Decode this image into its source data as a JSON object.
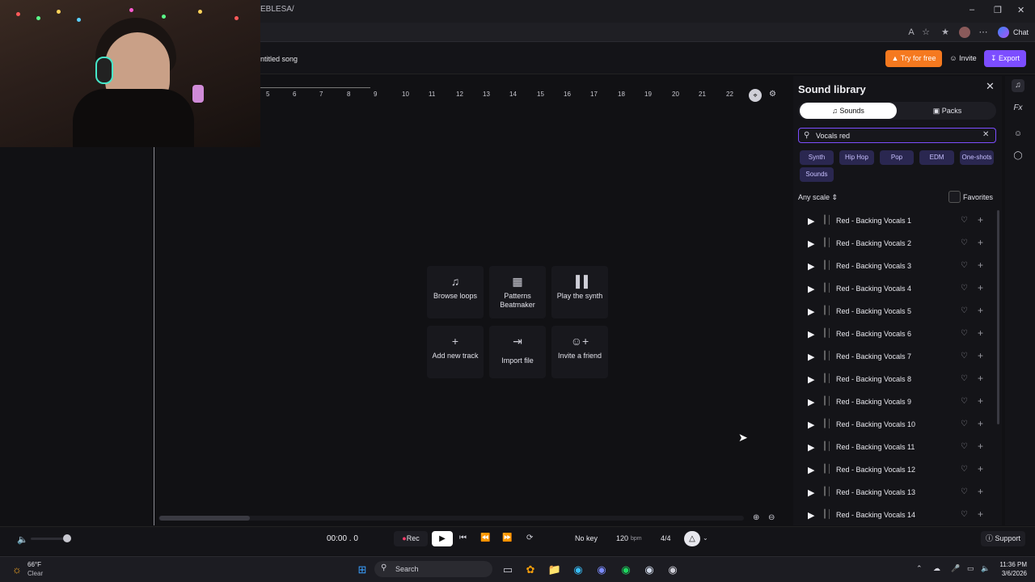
{
  "browser": {
    "url_fragment": "EBLESA/",
    "window_controls": [
      "minimize-icon",
      "restore-icon",
      "close-icon"
    ],
    "chat_label": "Chat"
  },
  "header": {
    "song_title": "ntitled song",
    "try_label": "Try for free",
    "invite_label": "Invite",
    "export_label": "Export"
  },
  "ruler": [
    "5",
    "6",
    "7",
    "8",
    "9",
    "10",
    "11",
    "12",
    "13",
    "14",
    "15",
    "16",
    "17",
    "18",
    "19",
    "20",
    "21",
    "22"
  ],
  "start_tiles": [
    {
      "label": "Browse loops",
      "icon": "music-note-icon"
    },
    {
      "label": "Patterns Beatmaker",
      "icon": "grid-icon"
    },
    {
      "label": "Play the synth",
      "icon": "piano-icon"
    },
    {
      "label": "Add new track",
      "icon": "plus-icon"
    },
    {
      "label": "Import file",
      "icon": "import-icon"
    },
    {
      "label": "Invite a friend",
      "icon": "add-user-icon"
    }
  ],
  "library": {
    "title": "Sound library",
    "tab_sounds": "Sounds",
    "tab_packs": "Packs",
    "search_value": "Vocals red",
    "chips": [
      "Synth",
      "Hip Hop",
      "Pop",
      "EDM",
      "One-shots",
      "Sounds"
    ],
    "scale_label": "Any scale",
    "favorites_label": "Favorites",
    "items": [
      "Red - Backing Vocals 1",
      "Red - Backing Vocals 2",
      "Red - Backing Vocals 3",
      "Red - Backing Vocals 4",
      "Red - Backing Vocals 5",
      "Red - Backing Vocals 6",
      "Red - Backing Vocals 7",
      "Red - Backing Vocals 8",
      "Red - Backing Vocals 9",
      "Red - Backing Vocals 10",
      "Red - Backing Vocals 11",
      "Red - Backing Vocals 12",
      "Red - Backing Vocals 13",
      "Red - Backing Vocals 14"
    ]
  },
  "rail": {
    "fx_label": "Fx"
  },
  "transport": {
    "time": "00:00 . 0",
    "rec_label": "Rec",
    "key": "No key",
    "bpm": "120",
    "bpm_unit": "bpm",
    "time_signature": "4/4",
    "support_label": "Support"
  },
  "taskbar": {
    "temperature": "66°F",
    "condition": "Clear",
    "search_label": "Search",
    "clock": "11:36 PM",
    "date": "3/6/2026"
  },
  "colors": {
    "accent": "#7c4dff",
    "try_button": "#f5791f",
    "background": "#111114",
    "rec_dot": "#ff3b6b"
  }
}
